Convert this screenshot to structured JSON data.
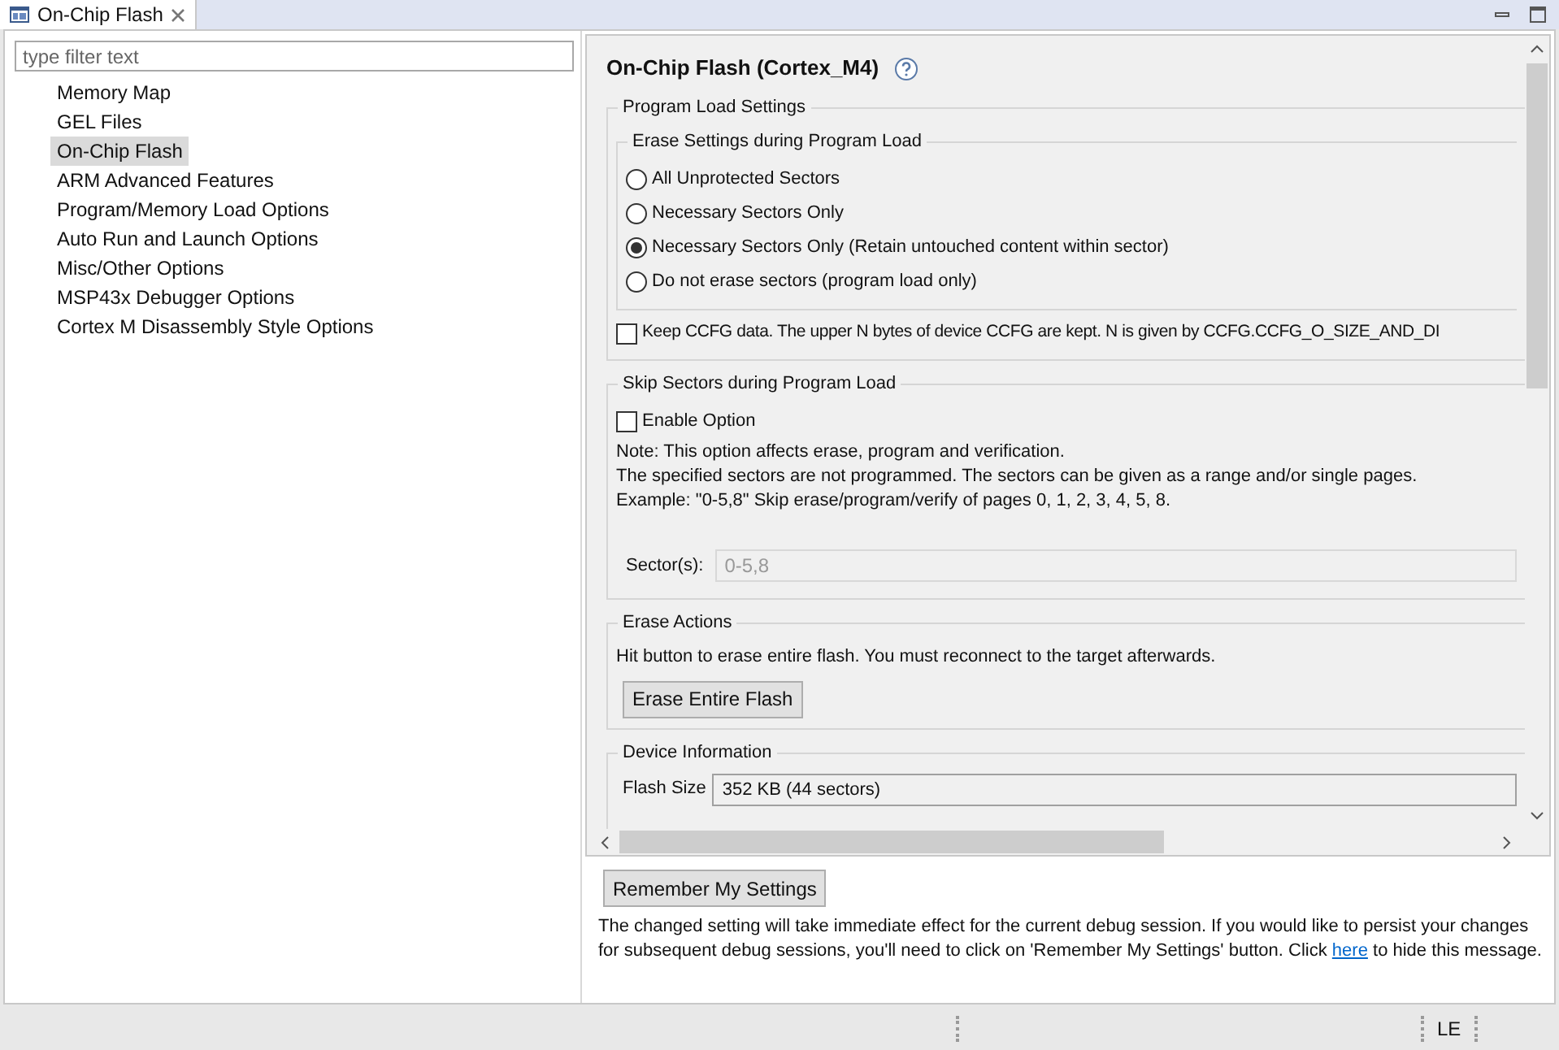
{
  "tab": {
    "title": "On-Chip Flash"
  },
  "filter": {
    "placeholder": "type filter text"
  },
  "nav_items": [
    {
      "label": "Memory Map",
      "selected": false
    },
    {
      "label": "GEL Files",
      "selected": false
    },
    {
      "label": "On-Chip Flash",
      "selected": true
    },
    {
      "label": "ARM Advanced Features",
      "selected": false
    },
    {
      "label": "Program/Memory Load Options",
      "selected": false
    },
    {
      "label": "Auto Run and Launch Options",
      "selected": false
    },
    {
      "label": "Misc/Other Options",
      "selected": false
    },
    {
      "label": "MSP43x Debugger Options",
      "selected": false
    },
    {
      "label": "Cortex M Disassembly Style Options",
      "selected": false
    }
  ],
  "page": {
    "title": "On-Chip Flash (Cortex_M4)",
    "program_load": {
      "title": "Program Load Settings",
      "erase_group": {
        "title": "Erase Settings during Program Load",
        "options": [
          {
            "label": "All Unprotected Sectors",
            "selected": false
          },
          {
            "label": "Necessary Sectors Only",
            "selected": false
          },
          {
            "label": "Necessary Sectors Only (Retain untouched content within sector)",
            "selected": true
          },
          {
            "label": "Do not erase sectors (program load only)",
            "selected": false
          }
        ]
      },
      "keep_ccfg": {
        "label": "Keep CCFG data. The upper N bytes of device CCFG are kept. N is given by CCFG.CCFG_O_SIZE_AND_DI",
        "checked": false
      }
    },
    "skip_sectors": {
      "title": "Skip Sectors during Program Load",
      "enable": {
        "label": "Enable Option",
        "checked": false
      },
      "notes": [
        "Note: This option affects erase, program and verification.",
        "The specified sectors are not programmed. The sectors can be given as a range and/or single pages.",
        "Example: \"0-5,8\" Skip erase/program/verify of pages 0, 1, 2, 3, 4, 5, 8."
      ],
      "sectors": {
        "label": "Sector(s):",
        "placeholder": "0-5,8",
        "disabled": true
      }
    },
    "erase_actions": {
      "title": "Erase Actions",
      "text": "Hit button to erase entire flash. You must reconnect to the target afterwards.",
      "button": "Erase Entire Flash"
    },
    "device_info": {
      "title": "Device Information",
      "flash_size": {
        "label": "Flash Size",
        "value": "352 KB (44 sectors)"
      }
    }
  },
  "remember_button": "Remember My Settings",
  "message": {
    "before": "The changed setting will take immediate effect for the current debug session.  If you would like to persist your changes for subsequent debug sessions, you'll need to click on 'Remember My Settings' button. Click ",
    "link": "here",
    "after": " to hide this message."
  },
  "status_bar": {
    "mode": "LE"
  }
}
